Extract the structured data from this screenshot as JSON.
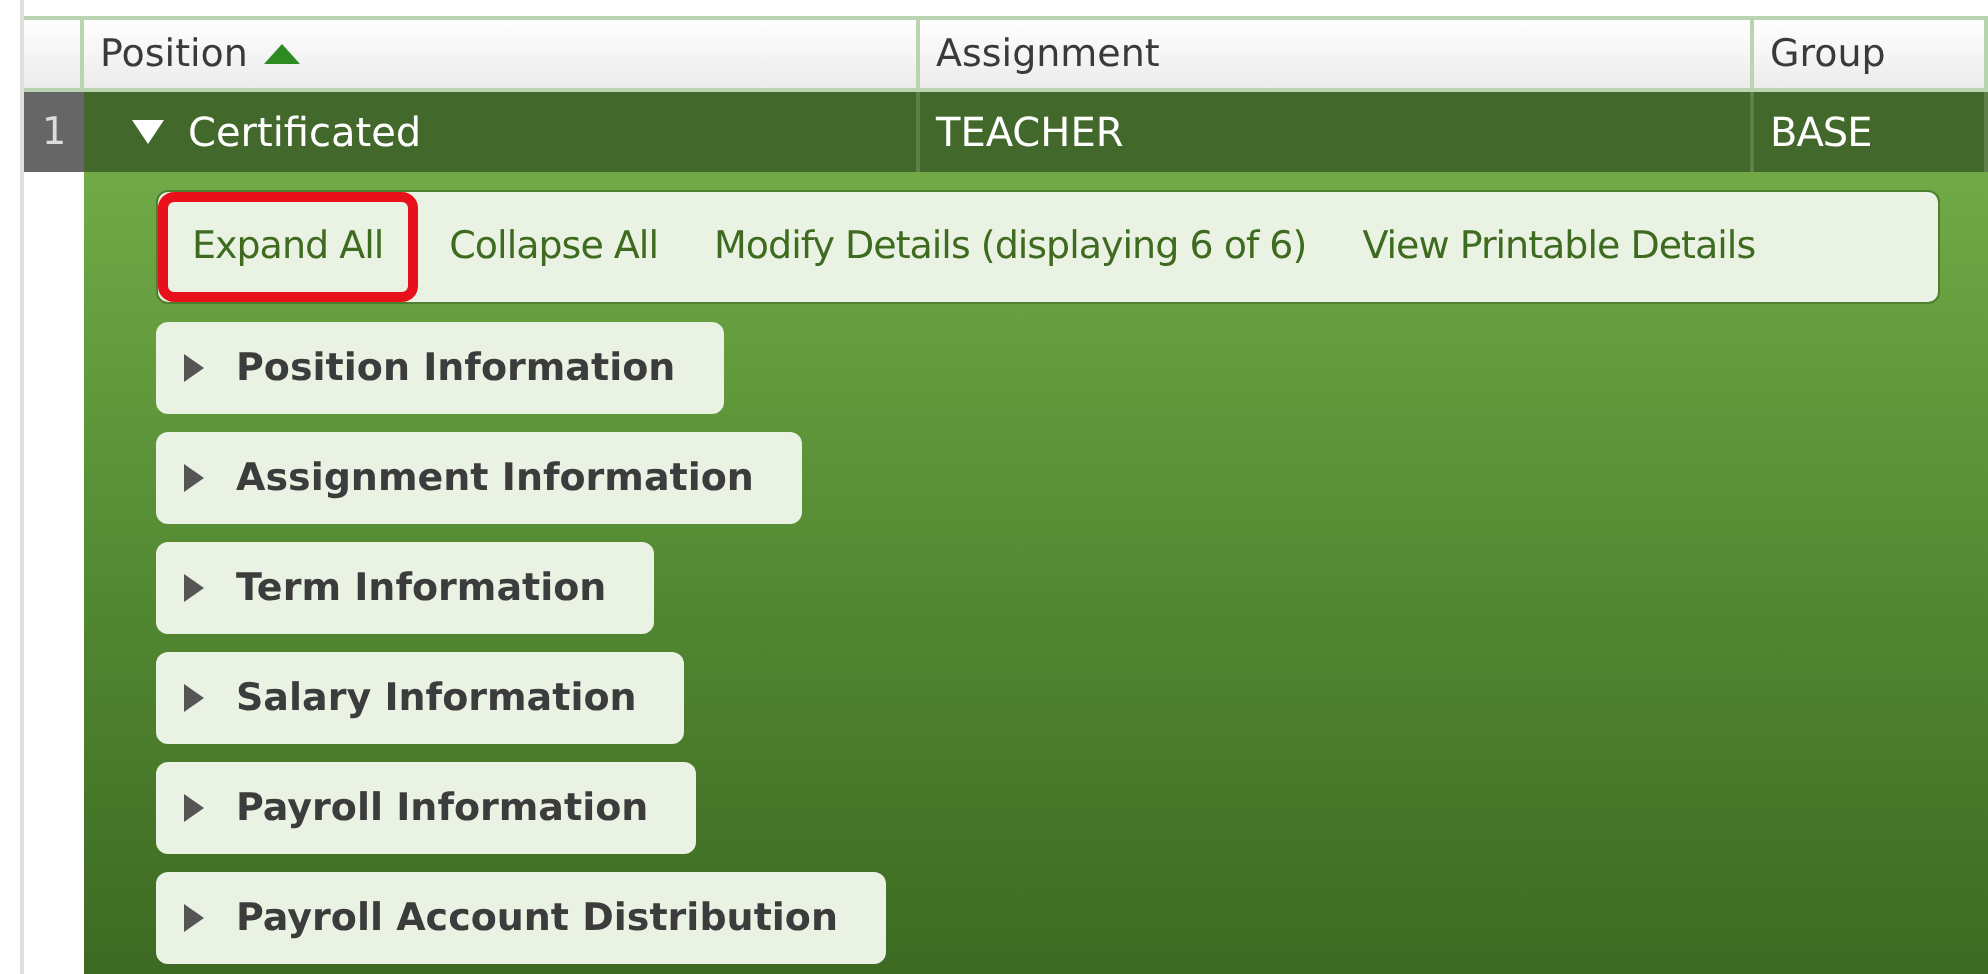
{
  "table": {
    "columns": [
      {
        "label": "Position",
        "sorted_ascending": true
      },
      {
        "label": "Assignment",
        "sorted_ascending": false
      },
      {
        "label": "Group",
        "sorted_ascending": false
      }
    ],
    "rows": [
      {
        "number": "1",
        "expanded": true,
        "cells": [
          "Certificated",
          "TEACHER",
          "BASE"
        ]
      }
    ]
  },
  "toolbar": [
    {
      "label": "Expand All",
      "highlighted": true
    },
    {
      "label": "Collapse All",
      "highlighted": false
    },
    {
      "label": "Modify Details (displaying 6 of 6)",
      "highlighted": false
    },
    {
      "label": "View Printable Details",
      "highlighted": false
    }
  ],
  "sections": [
    {
      "label": "Position Information",
      "expanded": false
    },
    {
      "label": "Assignment Information",
      "expanded": false
    },
    {
      "label": "Term Information",
      "expanded": false
    },
    {
      "label": "Salary Information",
      "expanded": false
    },
    {
      "label": "Payroll Information",
      "expanded": false
    },
    {
      "label": "Payroll Account Distribution",
      "expanded": false
    }
  ]
}
